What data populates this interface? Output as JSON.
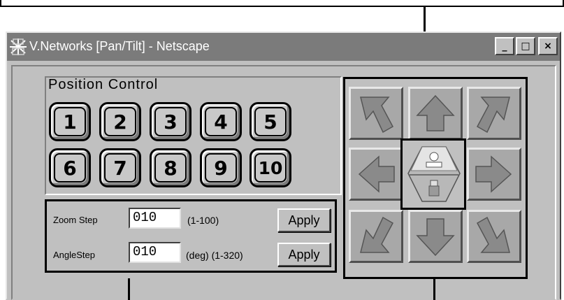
{
  "window": {
    "title": "V.Networks [Pan/Tilt] - Netscape",
    "controls": {
      "minimize": "_",
      "maximize": "□",
      "close": "×"
    },
    "titlebar_color": "#7b7b7b"
  },
  "position_control": {
    "label": "Position Control",
    "presets": [
      "1",
      "2",
      "3",
      "4",
      "5",
      "6",
      "7",
      "8",
      "9",
      "10"
    ]
  },
  "zoom": {
    "label": "Zoom Step",
    "value": "010",
    "range": "(1-100)",
    "apply_label": "Apply"
  },
  "angle": {
    "label": "AngleStep",
    "value": "010",
    "range": "(deg) (1-320)",
    "apply_label": "Apply"
  },
  "pan_tilt": {
    "icons": [
      "arrow-up-left-icon",
      "arrow-up-icon",
      "arrow-up-right-icon",
      "arrow-left-icon",
      "home-position-icon",
      "arrow-right-icon",
      "arrow-down-left-icon",
      "arrow-down-icon",
      "arrow-down-right-icon"
    ]
  },
  "colors": {
    "accent": "#000000",
    "button_face": "#c0c0c0",
    "arrow_fill": "#8a8a8a"
  }
}
